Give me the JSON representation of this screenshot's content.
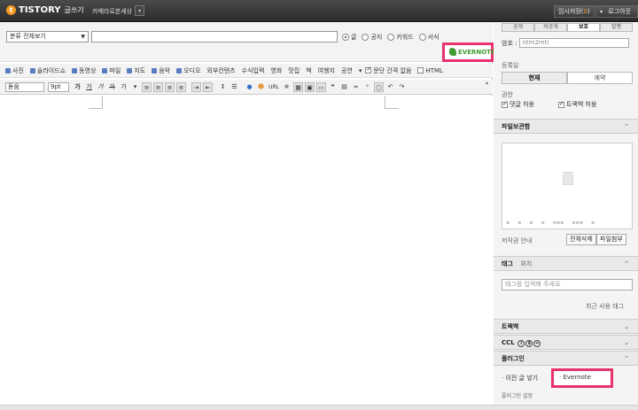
{
  "topbar": {
    "brand": "TISTORY",
    "brand_sub": "글쓰기",
    "blog_name": "카메라로본세상",
    "temp_save": "임시저장",
    "temp_count": "0",
    "logout": "로그아웃"
  },
  "editor": {
    "category": "분류 전체보기",
    "post_types": [
      "글",
      "공지",
      "키워드",
      "서식"
    ],
    "evernote": "EVERNOTE",
    "insert_menu": [
      "사진",
      "슬라이드쇼",
      "동영상",
      "파일",
      "지도",
      "음악",
      "오디오",
      "외부컨텐츠",
      "수식입력",
      "영화",
      "맛집",
      "책",
      "여행지",
      "공연"
    ],
    "paragraph_gap": "문단 간격 없음",
    "html": "HTML",
    "font": "돋움",
    "font_size": "9pt",
    "format_buttons": [
      "가",
      "가",
      "가",
      "가",
      "가"
    ],
    "url_label": "URL"
  },
  "sidebar": {
    "visibility": [
      "공개",
      "비공개",
      "보호",
      "발행"
    ],
    "password_label": "암호 :",
    "password_value": "ntm2mti",
    "publish_label": "등록일",
    "publish_options": [
      "현재",
      "예약"
    ],
    "permission_label": "권한",
    "permissions": [
      "댓글 허용",
      "트랙백 허용"
    ],
    "file_section": "파일보관함",
    "file_tools": [
      "≡",
      "≡",
      "≡",
      "≡",
      "≡≡≡",
      "≡≡≡",
      "≡"
    ],
    "filename_guide": "저작권 안내",
    "delete_all": "전체삭제",
    "attach_file": "파일첨부",
    "tag_section": "태그",
    "location": "위치",
    "tag_placeholder": "태그를 입력해 주세요",
    "recent_tags": "최근 사용 태그",
    "trackback": "트랙백",
    "ccl": "CCL",
    "plugin_section": "플러그인",
    "plugins": [
      "이전 글 넣기",
      "Evernote"
    ],
    "plugin_settings": "플러그인 설정"
  }
}
